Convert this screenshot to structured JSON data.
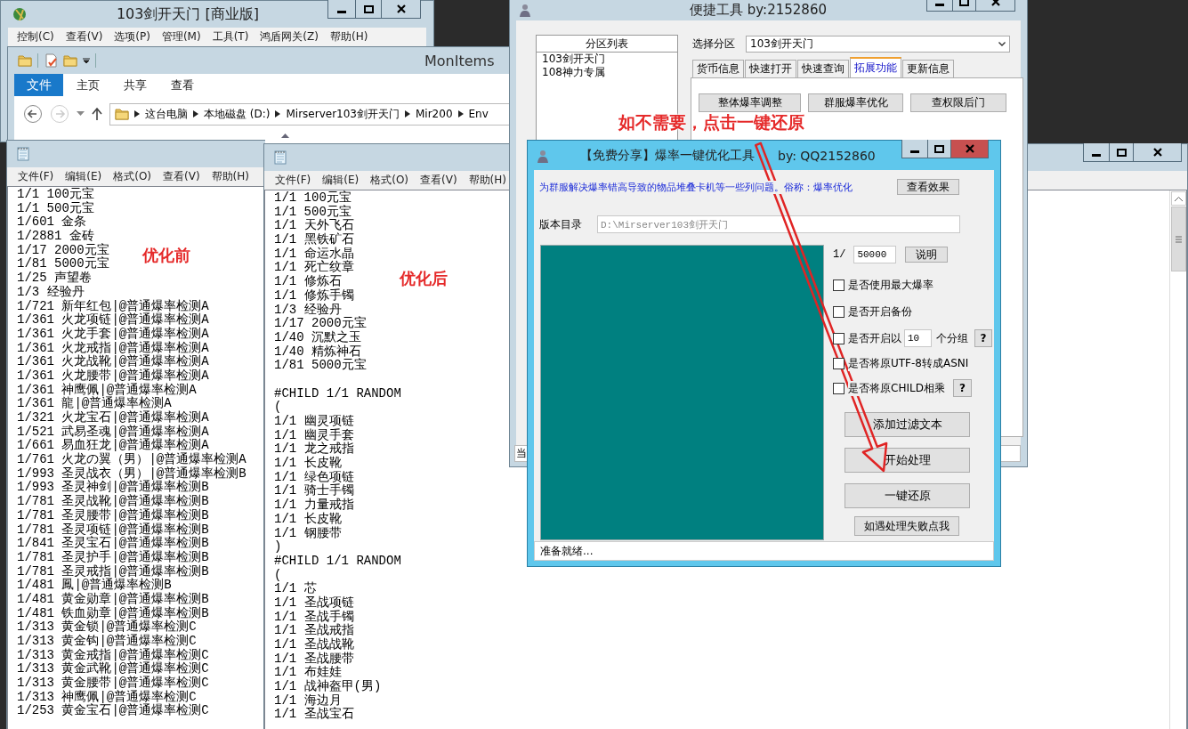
{
  "server_window": {
    "title": "103剑开天门 [商业版]",
    "menu": [
      "控制(C)",
      "查看(V)",
      "选项(P)",
      "管理(M)",
      "工具(T)",
      "鸿盾网关(Z)",
      "帮助(H)"
    ]
  },
  "explorer": {
    "title": "MonItems",
    "file_tab": "文件",
    "tabs": [
      "主页",
      "共享",
      "查看"
    ],
    "breadcrumb": [
      "这台电脑",
      "本地磁盘 (D:)",
      "Mirserver103剑开天门",
      "Mir200",
      "Env"
    ]
  },
  "notepad_before": {
    "menu": [
      "文件(F)",
      "编辑(E)",
      "格式(O)",
      "查看(V)",
      "帮助(H)"
    ],
    "text": "1/1 100元宝\n1/1 500元宝\n1/601 金条\n1/2881 金砖\n1/17 2000元宝\n1/81 5000元宝\n1/25 声望卷\n1/3 经验丹\n1/721 新年红包|@普通爆率检测A\n1/361 火龙项链|@普通爆率检测A\n1/361 火龙手套|@普通爆率检测A\n1/361 火龙戒指|@普通爆率检测A\n1/361 火龙战靴|@普通爆率检测A\n1/361 火龙腰带|@普通爆率检测A\n1/361 神鹰佩|@普通爆率检测A\n1/361 龍|@普通爆率检测A\n1/321 火龙宝石|@普通爆率检测A\n1/521 武易圣魂|@普通爆率检测A\n1/661 易血狂龙|@普通爆率检测A\n1/761 火龙の翼（男）|@普通爆率检测A\n1/993 圣灵战衣（男）|@普通爆率检测B\n1/993 圣灵神剑|@普通爆率检测B\n1/781 圣灵战靴|@普通爆率检测B\n1/781 圣灵腰带|@普通爆率检测B\n1/781 圣灵项链|@普通爆率检测B\n1/841 圣灵宝石|@普通爆率检测B\n1/781 圣灵护手|@普通爆率检测B\n1/781 圣灵戒指|@普通爆率检测B\n1/481 鳳|@普通爆率检测B\n1/481 黄金勋章|@普通爆率检测B\n1/481 铁血勋章|@普通爆率检测B\n1/313 黄金锁|@普通爆率检测C\n1/313 黄金钩|@普通爆率检测C\n1/313 黄金戒指|@普通爆率检测C\n1/313 黄金武靴|@普通爆率检测C\n1/313 黄金腰带|@普通爆率检测C\n1/313 神鹰佩|@普通爆率检测C\n1/253 黄金宝石|@普通爆率检测C"
  },
  "notepad_after": {
    "menu": [
      "文件(F)",
      "编辑(E)",
      "格式(O)",
      "查看(V)",
      "帮助(H)"
    ],
    "text": "1/1 100元宝\n1/1 500元宝\n1/1 天外飞石\n1/1 黑铁矿石\n1/1 命运水晶\n1/1 死亡纹章\n1/1 修炼石\n1/1 修炼手镯\n1/3 经验丹\n1/17 2000元宝\n1/40 沉默之玉\n1/40 精炼神石\n1/81 5000元宝\n\n#CHILD 1/1 RANDOM\n(\n1/1 幽灵项链\n1/1 幽灵手套\n1/1 龙之戒指\n1/1 长皮靴\n1/1 绿色项链\n1/1 骑士手镯\n1/1 力量戒指\n1/1 长皮靴\n1/1 钢腰带\n)\n#CHILD 1/1 RANDOM\n(\n1/1 芯\n1/1 圣战项链\n1/1 圣战手镯\n1/1 圣战戒指\n1/1 圣战战靴\n1/1 圣战腰带\n1/1 布娃娃\n1/1 战神盔甲(男)\n1/1 海边月\n1/1 圣战宝石"
  },
  "quick_tool": {
    "title": "便捷工具 by:2152860",
    "list_header": "分区列表",
    "partitions": [
      "103剑开天门",
      "108神力专属"
    ],
    "select_label": "选择分区",
    "select_value": "103剑开天门",
    "tabs": [
      {
        "label": "货币信息",
        "selected": false
      },
      {
        "label": "快速打开",
        "selected": false
      },
      {
        "label": "快速查询",
        "selected": false
      },
      {
        "label": "拓展功能",
        "selected": true
      },
      {
        "label": "更新信息",
        "selected": false
      }
    ],
    "buttons": [
      "整体爆率调整",
      "群服爆率优化",
      "查权限后门"
    ],
    "status": "当"
  },
  "dialog": {
    "title": "【免费分享】爆率一键优化工具",
    "author": "by: QQ2152860",
    "description": "为群服解决爆率错高导致的物品堆叠卡机等一些列问题。俗称：爆率优化",
    "view_button": "查看效果",
    "dir_label": "版本目录",
    "dir_value": "D:\\Mirserver103剑开天门",
    "ratio_prefix": "1/",
    "ratio_value": "50000",
    "explain_button": "说明",
    "options": [
      {
        "kind": "checkbox",
        "label": "是否使用最大爆率",
        "checked": false
      },
      {
        "kind": "checkbox",
        "label": "是否开启备份",
        "checked": false
      },
      {
        "kind": "group",
        "label": "是否开启以",
        "value": "10",
        "suffix": "个分组",
        "help": "?",
        "checked": false
      },
      {
        "kind": "checkbox",
        "label": "是否将原UTF-8转成ASNI",
        "checked": false
      },
      {
        "kind": "help",
        "label": "是否将原CHILD相乘",
        "help": "?",
        "checked": false
      }
    ],
    "actions": [
      "添加过滤文本",
      "开始处理",
      "一键还原"
    ],
    "fail_button": "如遇处理失败点我",
    "status": "准备就绪..."
  },
  "annotations": [
    "优化前",
    "优化后",
    "如不需要，点击一键还原"
  ]
}
